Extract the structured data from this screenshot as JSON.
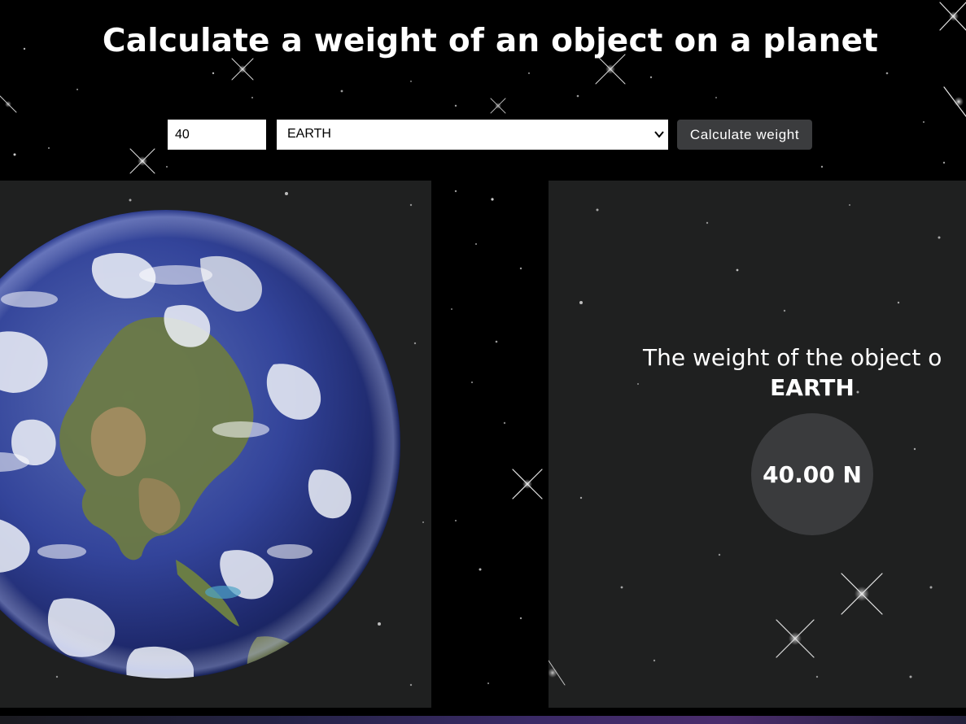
{
  "header": {
    "title": "Calculate a weight of an object on a planet"
  },
  "form": {
    "mass_value": "40",
    "selected_planet": "EARTH",
    "calculate_label": "Calculate weight"
  },
  "result": {
    "text": "The weight of the object o",
    "planet": "EARTH",
    "value": "40.00 N"
  },
  "icons": {
    "select_chevron": "chevron-down-icon",
    "planet": "earth-image"
  },
  "colors": {
    "background": "#000000",
    "panel": "#1f2020",
    "button": "#3b3c3e",
    "result_circle": "#3a3b3d",
    "text": "#ffffff"
  }
}
